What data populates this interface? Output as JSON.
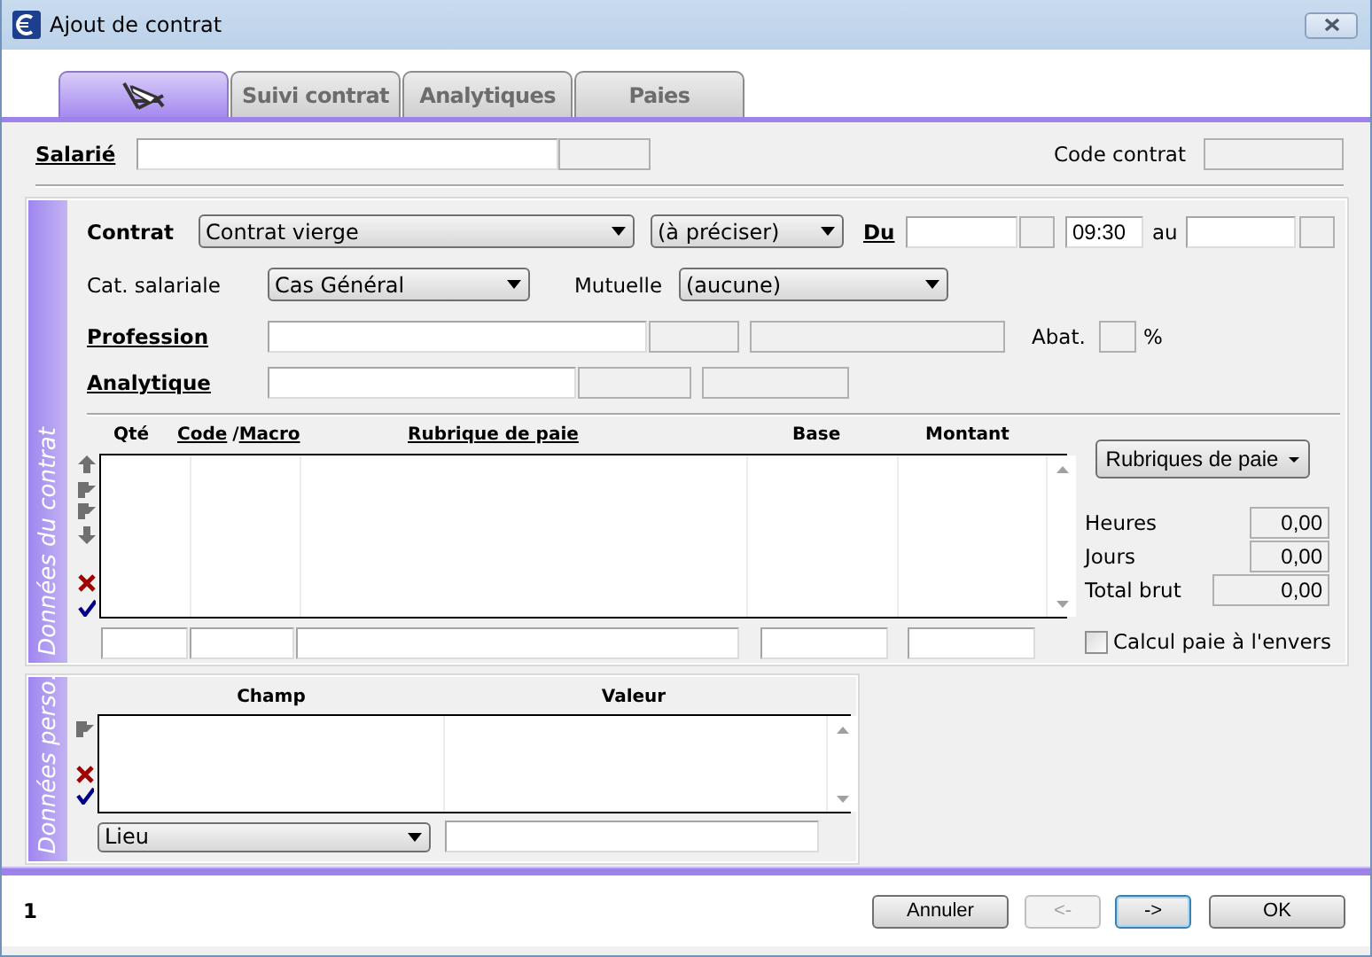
{
  "window": {
    "title": "Ajout de contrat"
  },
  "tabs": [
    {
      "kind": "icon",
      "selected": true
    },
    {
      "kind": "text",
      "label": "Suivi contrat",
      "selected": false
    },
    {
      "kind": "text",
      "label": "Analytiques",
      "selected": false
    },
    {
      "kind": "text",
      "label": "Paies",
      "selected": false
    }
  ],
  "employee": {
    "label": "Salarié",
    "link": true
  },
  "contract_code": {
    "label": "Code contrat",
    "link": false
  },
  "contract_section": {
    "title": "Données du contrat",
    "contract": {
      "label": "Contrat",
      "link": false,
      "value": "Contrat vierge"
    },
    "contract_type": {
      "value": "(à préciser)"
    },
    "from": {
      "label": "Du",
      "link": true,
      "time": "09:30"
    },
    "to": {
      "label": "au",
      "link": false
    },
    "category": {
      "label": "Cat. salariale",
      "link": false,
      "value": "Cas Général"
    },
    "mutual": {
      "label": "Mutuelle",
      "link": false,
      "value": "(aucune)"
    },
    "profession": {
      "label": "Profession",
      "link": true
    },
    "abatement": {
      "label": "Abat.",
      "link": false,
      "unit": "%"
    },
    "analytics": {
      "label": "Analytique",
      "link": true
    },
    "columns": [
      {
        "label": "Qté",
        "link": false
      },
      {
        "label": "Code",
        "separator": "/",
        "label_2": "Macro",
        "link": true
      },
      {
        "label": "Rubrique de paie",
        "link": true
      },
      {
        "label": "Base",
        "link": false
      },
      {
        "label": "Montant",
        "link": false
      }
    ],
    "pay_items_button": "Rubriques de paie",
    "totals": [
      {
        "label": "Heures",
        "value": "0,00"
      },
      {
        "label": "Jours",
        "value": "0,00"
      },
      {
        "label": "Total brut",
        "value": "0,00"
      }
    ],
    "reverse_calc": {
      "label": "Calcul paie à l'envers",
      "checked": false
    }
  },
  "personal_section": {
    "title": "Données perso.",
    "columns": [
      "Champ",
      "Valeur"
    ],
    "field": {
      "value": "Lieu"
    }
  },
  "footer": {
    "page": "1",
    "buttons": [
      {
        "label": "Annuler",
        "disabled": false,
        "focused": false
      },
      {
        "label": "<-",
        "disabled": true,
        "focused": false
      },
      {
        "label": "->",
        "disabled": false,
        "focused": true
      },
      {
        "label": "OK",
        "disabled": false,
        "focused": false
      }
    ]
  }
}
